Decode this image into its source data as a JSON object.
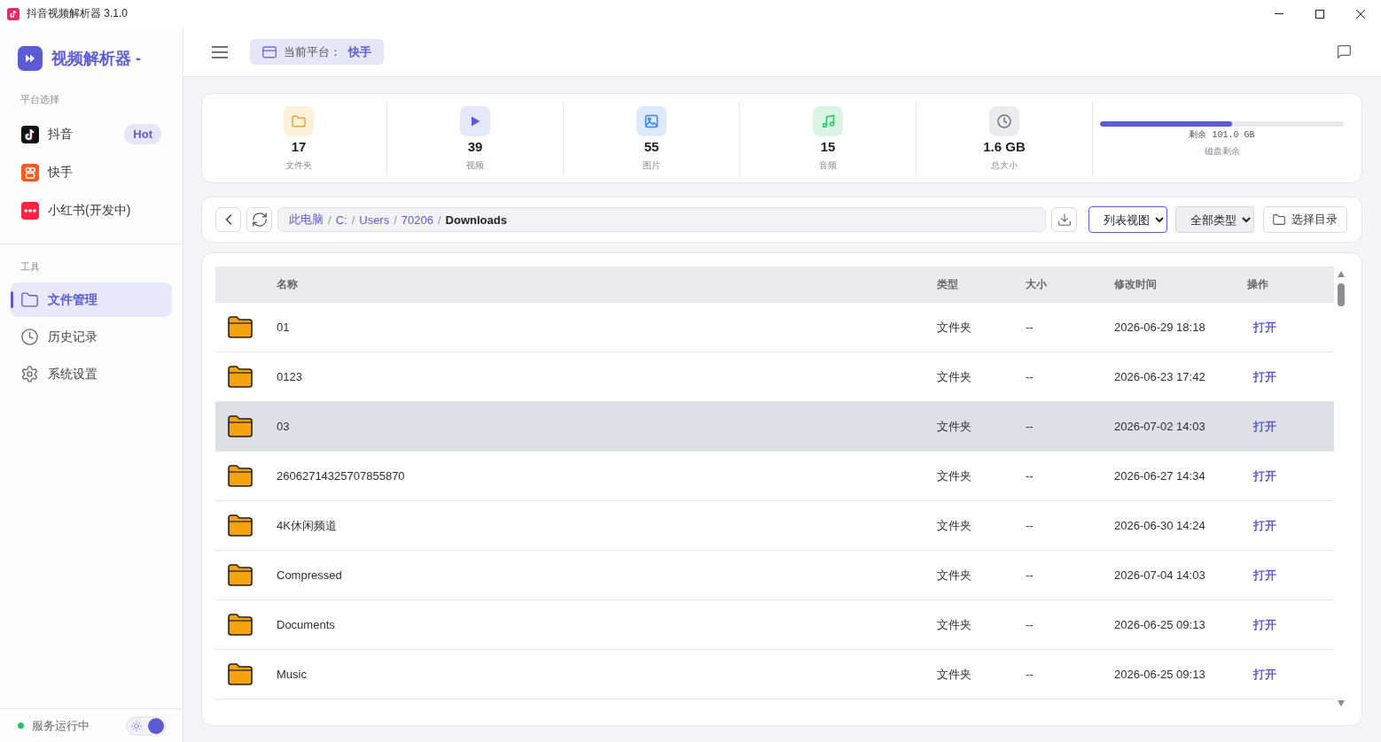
{
  "window": {
    "title": "抖音视频解析器 3.1.0"
  },
  "sidebar": {
    "brand": "视频解析器 -",
    "platforms": {
      "title": "平台选择",
      "items": [
        {
          "kind": "note",
          "label": "抖音",
          "badge": "Hot"
        },
        {
          "kind": "circles",
          "label": "快手"
        },
        {
          "kind": "label",
          "label": "小红书(开发中)"
        }
      ]
    },
    "tools": {
      "title": "工具",
      "items": [
        {
          "kind": "folder",
          "label": "文件管理",
          "selected": true
        },
        {
          "kind": "clock",
          "label": "历史记录",
          "selected": false
        },
        {
          "kind": "gear",
          "label": "系统设置",
          "selected": false
        }
      ]
    },
    "status": {
      "text": "服务运行中",
      "running": true
    },
    "theme_toggle": {
      "on": true
    }
  },
  "header": {
    "platform_chip": {
      "label": "当前平台：",
      "value": "快手"
    }
  },
  "stats_panel": {
    "stats": [
      {
        "kind": "folder",
        "value": "17",
        "label": "文件夹"
      },
      {
        "kind": "video",
        "value": "39",
        "label": "视频"
      },
      {
        "kind": "image",
        "value": "55",
        "label": "图片"
      },
      {
        "kind": "audio",
        "value": "15",
        "label": "音频"
      },
      {
        "kind": "size",
        "value": "1.6 GB",
        "label": "总大小"
      }
    ],
    "disk": {
      "level": 0.54,
      "reading": "剩余 101.0 GB",
      "label": "磁盘剩余"
    }
  },
  "toolbar": {
    "breadcrumb": {
      "separator": "/",
      "items": [
        {
          "label": "此电脑",
          "current": false
        },
        {
          "label": "C:",
          "current": false
        },
        {
          "label": "Users",
          "current": false
        },
        {
          "label": "70206",
          "current": false
        },
        {
          "label": "Downloads",
          "current": true
        }
      ]
    },
    "view_select": {
      "value": "列表视图",
      "focused": true
    },
    "type_select": {
      "value": "全部类型",
      "focused": false
    },
    "choose_dir_button": "选择目录"
  },
  "table": {
    "columns": [
      "名称",
      "类型",
      "大小",
      "修改时间",
      "操作"
    ],
    "rows": [
      {
        "kind": "folder",
        "name": "01",
        "type": "文件夹",
        "size": "--",
        "modified": "2026-06-29 18:18",
        "action": "打开",
        "selected": false
      },
      {
        "kind": "folder",
        "name": "0123",
        "type": "文件夹",
        "size": "--",
        "modified": "2026-06-23 17:42",
        "action": "打开",
        "selected": false
      },
      {
        "kind": "folder",
        "name": "03",
        "type": "文件夹",
        "size": "--",
        "modified": "2026-07-02 14:03",
        "action": "打开",
        "selected": true
      },
      {
        "kind": "folder",
        "name": "26062714325707855870",
        "type": "文件夹",
        "size": "--",
        "modified": "2026-06-27 14:34",
        "action": "打开",
        "selected": false
      },
      {
        "kind": "folder",
        "name": "4K休闲频道",
        "type": "文件夹",
        "size": "--",
        "modified": "2026-06-30 14:24",
        "action": "打开",
        "selected": false
      },
      {
        "kind": "folder",
        "name": "Compressed",
        "type": "文件夹",
        "size": "--",
        "modified": "2026-07-04 14:03",
        "action": "打开",
        "selected": false
      },
      {
        "kind": "folder",
        "name": "Documents",
        "type": "文件夹",
        "size": "--",
        "modified": "2026-06-25 09:13",
        "action": "打开",
        "selected": false
      },
      {
        "kind": "folder",
        "name": "Music",
        "type": "文件夹",
        "size": "--",
        "modified": "2026-06-25 09:13",
        "action": "打开",
        "selected": false
      }
    ]
  }
}
